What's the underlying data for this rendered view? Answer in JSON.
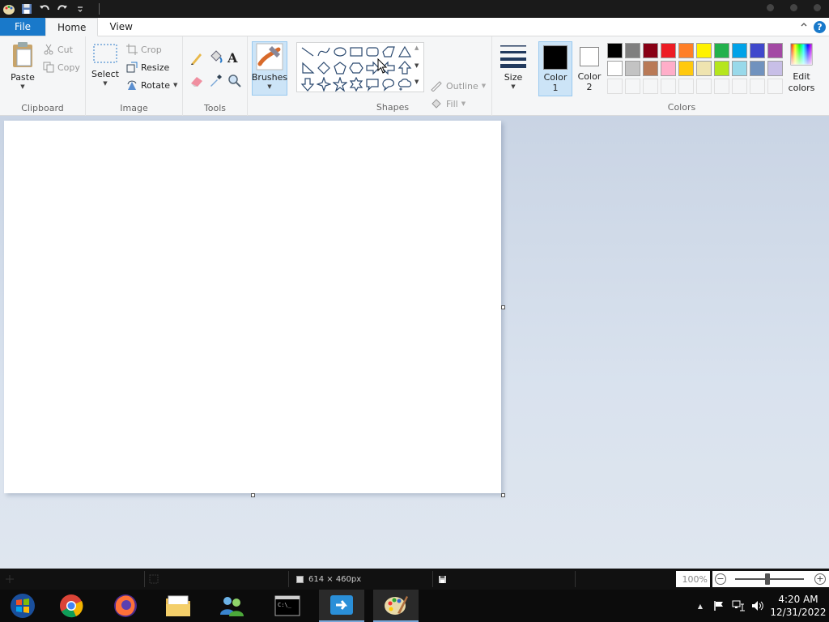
{
  "tabs": {
    "file": "File",
    "home": "Home",
    "view": "View",
    "help": "?"
  },
  "clipboard": {
    "paste": "Paste",
    "cut": "Cut",
    "copy": "Copy",
    "label": "Clipboard"
  },
  "image": {
    "select": "Select",
    "crop": "Crop",
    "resize": "Resize",
    "rotate": "Rotate",
    "label": "Image"
  },
  "tools": {
    "label": "Tools",
    "text_glyph": "A"
  },
  "brushes": {
    "label": "Brushes"
  },
  "shapes": {
    "outline": "Outline",
    "fill": "Fill",
    "label": "Shapes"
  },
  "colors": {
    "color1": "Color\n1",
    "color1_line1": "Color",
    "color1_line2": "1",
    "color2_line1": "Color",
    "color2_line2": "2",
    "edit_line1": "Edit",
    "edit_line2": "colors",
    "label": "Colors",
    "color1_value": "#000000",
    "color2_value": "#ffffff",
    "palette_row1": [
      "#000000",
      "#7f7f7f",
      "#880015",
      "#ed1c24",
      "#ff7f27",
      "#fff200",
      "#22b14c",
      "#00a2e8",
      "#3f48cc",
      "#a349a4"
    ],
    "palette_row2": [
      "#ffffff",
      "#c3c3c3",
      "#b97a57",
      "#ffaec9",
      "#ffc90e",
      "#efe4b0",
      "#b5e61d",
      "#99d9ea",
      "#7092be",
      "#c8bfe7"
    ]
  },
  "status": {
    "dimensions": "614 × 460px",
    "zoom": "100%"
  },
  "tray": {
    "time": "4:20 AM",
    "date": "12/31/2022"
  }
}
